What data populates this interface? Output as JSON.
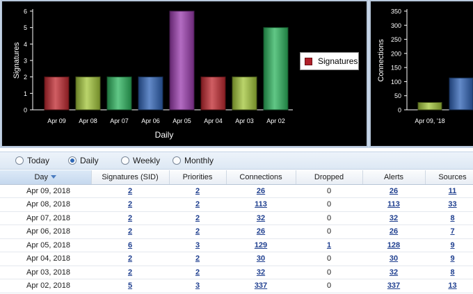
{
  "chart_data": [
    {
      "type": "bar",
      "categories": [
        "Apr 09",
        "Apr 08",
        "Apr 07",
        "Apr 06",
        "Apr 05",
        "Apr 04",
        "Apr 03",
        "Apr 02"
      ],
      "values": [
        2,
        2,
        2,
        2,
        6,
        2,
        2,
        5
      ],
      "colors": [
        "#c0282f",
        "#a3c63a",
        "#2cb45e",
        "#2f63b5",
        "#9a3bad",
        "#c0282f",
        "#a3c63a",
        "#2cb45e"
      ],
      "ylabel": "Signatures",
      "xlabel": "Daily",
      "ylim": [
        0,
        6
      ],
      "yticks": [
        0,
        1,
        2,
        3,
        4,
        5,
        6
      ],
      "legend": [
        "Signatures"
      ],
      "legend_position": "right"
    },
    {
      "type": "bar",
      "categories": [
        "Apr 09, '18"
      ],
      "values": [
        26,
        113
      ],
      "colors": [
        "#a3c63a",
        "#2f63b5"
      ],
      "ylabel": "Connections",
      "ylim": [
        0,
        350
      ],
      "yticks": [
        0,
        50,
        100,
        150,
        200,
        250,
        300,
        350
      ]
    }
  ],
  "radio": {
    "options": [
      "Today",
      "Daily",
      "Weekly",
      "Monthly"
    ],
    "selected": "Daily"
  },
  "table": {
    "columns": [
      "Day",
      "Signatures (SID)",
      "Priorities",
      "Connections",
      "Dropped",
      "Alerts",
      "Sources"
    ],
    "sorted_column": "Day",
    "rows": [
      [
        "Apr 09, 2018",
        "2",
        "2",
        "26",
        "0",
        "26",
        "11"
      ],
      [
        "Apr 08, 2018",
        "2",
        "2",
        "113",
        "0",
        "113",
        "33"
      ],
      [
        "Apr 07, 2018",
        "2",
        "2",
        "32",
        "0",
        "32",
        "8"
      ],
      [
        "Apr 06, 2018",
        "2",
        "2",
        "26",
        "0",
        "26",
        "7"
      ],
      [
        "Apr 05, 2018",
        "6",
        "3",
        "129",
        "1",
        "128",
        "9"
      ],
      [
        "Apr 04, 2018",
        "2",
        "2",
        "30",
        "0",
        "30",
        "9"
      ],
      [
        "Apr 03, 2018",
        "2",
        "2",
        "32",
        "0",
        "32",
        "8"
      ],
      [
        "Apr 02, 2018",
        "5",
        "3",
        "337",
        "0",
        "337",
        "13"
      ]
    ]
  }
}
